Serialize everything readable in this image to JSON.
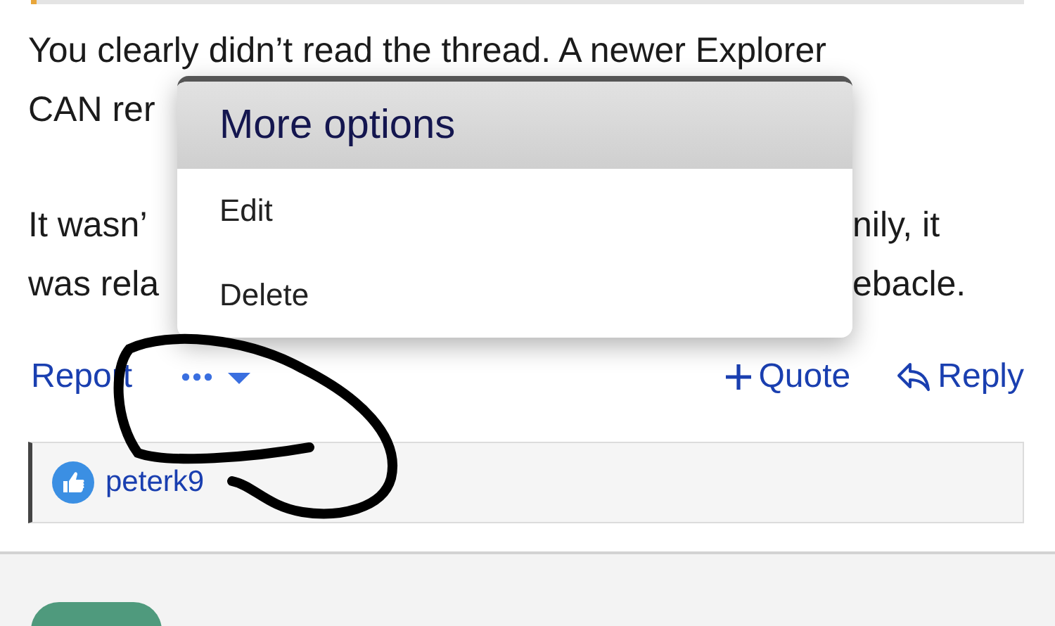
{
  "post": {
    "paragraphs": [
      {
        "lines": [
          [
            "You clearly didn’t read the thread. A newer Explorer"
          ],
          [
            "CAN rer"
          ]
        ]
      },
      {
        "lines": [
          [
            "It wasn’",
            "nily, it"
          ],
          [
            "was rela",
            "ebacle."
          ]
        ]
      }
    ]
  },
  "menu": {
    "title": "More options",
    "items": [
      "Edit",
      "Delete"
    ]
  },
  "actions": {
    "report": "Report",
    "quote": "Quote",
    "reply": "Reply"
  },
  "reactions": {
    "users": [
      "peterk9"
    ]
  }
}
